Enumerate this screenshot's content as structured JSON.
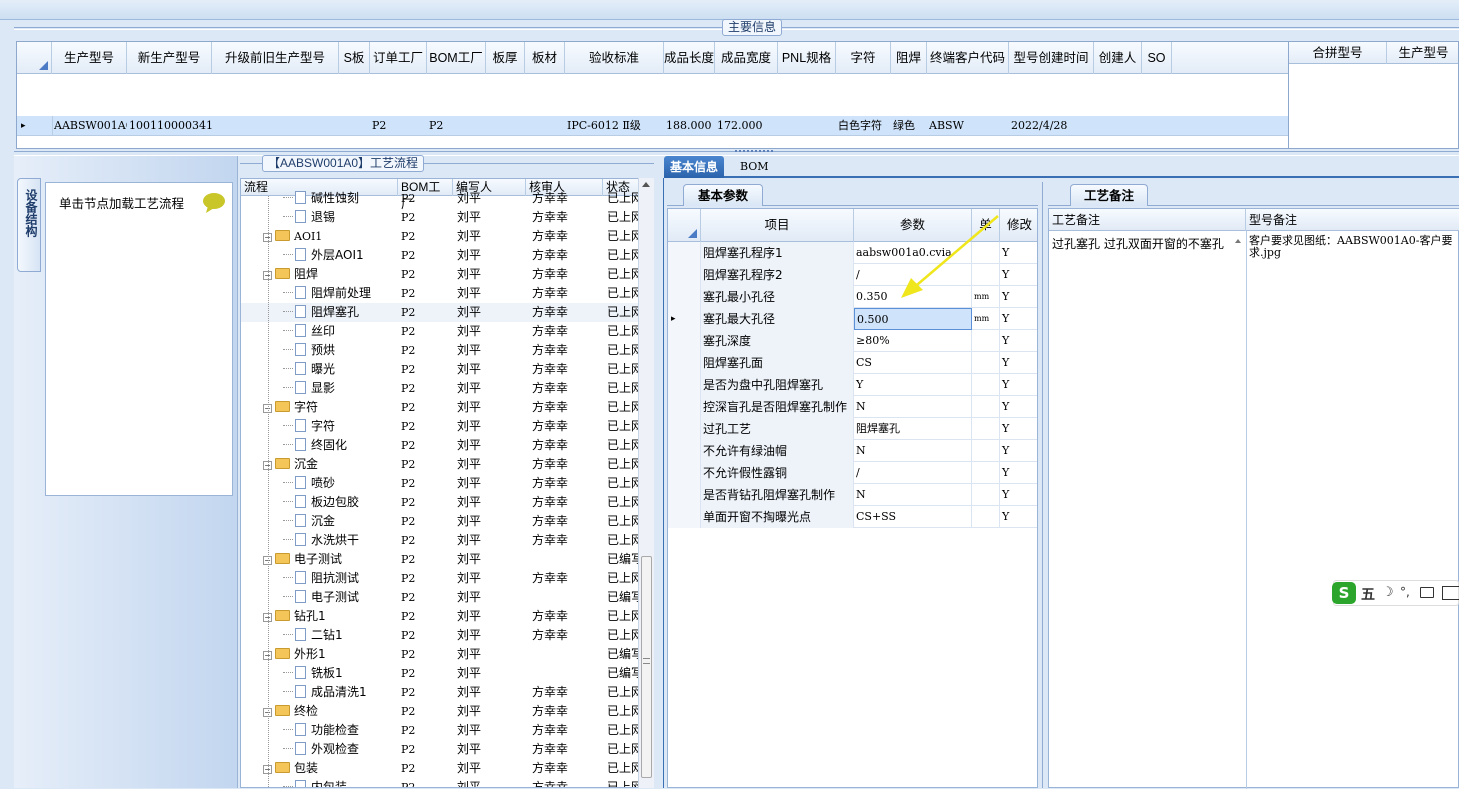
{
  "main_caption": "主要信息",
  "top_grid": {
    "headers": [
      "生产型号",
      "新生产型号",
      "升级前旧生产型号",
      "S板",
      "订单工厂",
      "BOM工厂",
      "板厚",
      "板材",
      "验收标准",
      "成品长度",
      "成品宽度",
      "PNL规格",
      "字符",
      "阻焊",
      "终端客户代码",
      "型号创建时间",
      "创建人",
      "SO"
    ],
    "row": [
      "AABSW001A0",
      "10011000034110",
      "",
      "",
      "P2",
      "P2",
      "",
      "",
      "IPC-6012 Ⅱ级",
      "188.000",
      "172.000",
      "",
      "白色字符",
      "绿色",
      "ABSW",
      "2022/4/28",
      "",
      ""
    ],
    "row_marker": "▸"
  },
  "side_grid": {
    "headers": [
      "合拼型号",
      "生产型号"
    ]
  },
  "left_panel": {
    "vertical_tab": "设备结构",
    "node_hint": "单击节点加载工艺流程"
  },
  "flow_caption": "【AABSW001A0】工艺流程",
  "tree": {
    "headers": [
      "流程",
      "BOM工厂",
      "编写人",
      "核审人",
      "状态"
    ],
    "rows": [
      {
        "lv": 2,
        "t": "page",
        "name": "碱性蚀刻",
        "bom": "P2",
        "w": "刘平",
        "r": "方幸幸",
        "s": "已上网"
      },
      {
        "lv": 2,
        "t": "page",
        "name": "退锡",
        "bom": "P2",
        "w": "刘平",
        "r": "方幸幸",
        "s": "已上网"
      },
      {
        "lv": 1,
        "t": "folder",
        "name": "AOI1",
        "bom": "P2",
        "w": "刘平",
        "r": "方幸幸",
        "s": "已上网",
        "mono": true
      },
      {
        "lv": 2,
        "t": "page",
        "name": "外层AOI1",
        "bom": "P2",
        "w": "刘平",
        "r": "方幸幸",
        "s": "已上网"
      },
      {
        "lv": 1,
        "t": "folder",
        "name": "阻焊",
        "bom": "P2",
        "w": "刘平",
        "r": "方幸幸",
        "s": "已上网"
      },
      {
        "lv": 2,
        "t": "page",
        "name": "阻焊前处理",
        "bom": "P2",
        "w": "刘平",
        "r": "方幸幸",
        "s": "已上网"
      },
      {
        "lv": 2,
        "t": "page",
        "name": "阻焊塞孔",
        "bom": "P2",
        "w": "刘平",
        "r": "方幸幸",
        "s": "已上网",
        "sel": true
      },
      {
        "lv": 2,
        "t": "page",
        "name": "丝印",
        "bom": "P2",
        "w": "刘平",
        "r": "方幸幸",
        "s": "已上网"
      },
      {
        "lv": 2,
        "t": "page",
        "name": "预烘",
        "bom": "P2",
        "w": "刘平",
        "r": "方幸幸",
        "s": "已上网"
      },
      {
        "lv": 2,
        "t": "page",
        "name": "曝光",
        "bom": "P2",
        "w": "刘平",
        "r": "方幸幸",
        "s": "已上网"
      },
      {
        "lv": 2,
        "t": "page",
        "name": "显影",
        "bom": "P2",
        "w": "刘平",
        "r": "方幸幸",
        "s": "已上网"
      },
      {
        "lv": 1,
        "t": "folder",
        "name": "字符",
        "bom": "P2",
        "w": "刘平",
        "r": "方幸幸",
        "s": "已上网"
      },
      {
        "lv": 2,
        "t": "page",
        "name": "字符",
        "bom": "P2",
        "w": "刘平",
        "r": "方幸幸",
        "s": "已上网"
      },
      {
        "lv": 2,
        "t": "page",
        "name": "终固化",
        "bom": "P2",
        "w": "刘平",
        "r": "方幸幸",
        "s": "已上网"
      },
      {
        "lv": 1,
        "t": "folder",
        "name": "沉金",
        "bom": "P2",
        "w": "刘平",
        "r": "方幸幸",
        "s": "已上网"
      },
      {
        "lv": 2,
        "t": "page",
        "name": "喷砂",
        "bom": "P2",
        "w": "刘平",
        "r": "方幸幸",
        "s": "已上网"
      },
      {
        "lv": 2,
        "t": "page",
        "name": "板边包胶",
        "bom": "P2",
        "w": "刘平",
        "r": "方幸幸",
        "s": "已上网"
      },
      {
        "lv": 2,
        "t": "page",
        "name": "沉金",
        "bom": "P2",
        "w": "刘平",
        "r": "方幸幸",
        "s": "已上网"
      },
      {
        "lv": 2,
        "t": "page",
        "name": "水洗烘干",
        "bom": "P2",
        "w": "刘平",
        "r": "方幸幸",
        "s": "已上网"
      },
      {
        "lv": 1,
        "t": "folder",
        "name": "电子测试",
        "bom": "P2",
        "w": "刘平",
        "r": "",
        "s": "已编写"
      },
      {
        "lv": 2,
        "t": "page",
        "name": "阻抗测试",
        "bom": "P2",
        "w": "刘平",
        "r": "方幸幸",
        "s": "已上网"
      },
      {
        "lv": 2,
        "t": "page",
        "name": "电子测试",
        "bom": "P2",
        "w": "刘平",
        "r": "",
        "s": "已编写"
      },
      {
        "lv": 1,
        "t": "folder",
        "name": "钻孔1",
        "bom": "P2",
        "w": "刘平",
        "r": "方幸幸",
        "s": "已上网"
      },
      {
        "lv": 2,
        "t": "page",
        "name": "二钻1",
        "bom": "P2",
        "w": "刘平",
        "r": "方幸幸",
        "s": "已上网"
      },
      {
        "lv": 1,
        "t": "folder",
        "name": "外形1",
        "bom": "P2",
        "w": "刘平",
        "r": "",
        "s": "已编写"
      },
      {
        "lv": 2,
        "t": "page",
        "name": "铣板1",
        "bom": "P2",
        "w": "刘平",
        "r": "",
        "s": "已编写"
      },
      {
        "lv": 2,
        "t": "page",
        "name": "成品清洗1",
        "bom": "P2",
        "w": "刘平",
        "r": "方幸幸",
        "s": "已上网"
      },
      {
        "lv": 1,
        "t": "folder",
        "name": "终检",
        "bom": "P2",
        "w": "刘平",
        "r": "方幸幸",
        "s": "已上网"
      },
      {
        "lv": 2,
        "t": "page",
        "name": "功能检查",
        "bom": "P2",
        "w": "刘平",
        "r": "方幸幸",
        "s": "已上网"
      },
      {
        "lv": 2,
        "t": "page",
        "name": "外观检查",
        "bom": "P2",
        "w": "刘平",
        "r": "方幸幸",
        "s": "已上网"
      },
      {
        "lv": 1,
        "t": "folder",
        "name": "包装",
        "bom": "P2",
        "w": "刘平",
        "r": "方幸幸",
        "s": "已上网"
      },
      {
        "lv": 2,
        "t": "page",
        "name": "内包装",
        "bom": "P2",
        "w": "刘平",
        "r": "方幸幸",
        "s": "已上网"
      }
    ]
  },
  "tabs": [
    "基本信息",
    "BOM"
  ],
  "basic_params_tab": "基本参数",
  "params": {
    "headers": [
      "项目",
      "参数",
      "单",
      "修改"
    ],
    "rows": [
      {
        "item": "阻焊塞孔程序1",
        "val": "aabsw001a0.cvia",
        "unit": "",
        "mod": "Y"
      },
      {
        "item": "阻焊塞孔程序2",
        "val": "/",
        "unit": "",
        "mod": "Y"
      },
      {
        "item": "塞孔最小孔径",
        "val": "0.350",
        "unit": "mm",
        "mod": "Y"
      },
      {
        "item": "塞孔最大孔径",
        "val": "0.500",
        "unit": "mm",
        "mod": "Y",
        "sel": true
      },
      {
        "item": "塞孔深度",
        "val": "≥80%",
        "unit": "",
        "mod": "Y"
      },
      {
        "item": "阻焊塞孔面",
        "val": "CS",
        "unit": "",
        "mod": "Y"
      },
      {
        "item": "是否为盘中孔阻焊塞孔",
        "val": "Y",
        "unit": "",
        "mod": "Y"
      },
      {
        "item": "控深盲孔是否阻焊塞孔制作",
        "val": "N",
        "unit": "",
        "mod": "Y"
      },
      {
        "item": "过孔工艺",
        "val": "阻焊塞孔",
        "unit": "",
        "mod": "Y"
      },
      {
        "item": "不允许有绿油帽",
        "val": "N",
        "unit": "",
        "mod": "Y"
      },
      {
        "item": "不允许假性露铜",
        "val": "/",
        "unit": "",
        "mod": "Y"
      },
      {
        "item": "是否背钻孔阻焊塞孔制作",
        "val": "N",
        "unit": "",
        "mod": "Y"
      },
      {
        "item": "单面开窗不掏曝光点",
        "val": "CS+SS",
        "unit": "",
        "mod": "Y"
      }
    ]
  },
  "notes_tab": "工艺备注",
  "notes": {
    "headers": [
      "工艺备注",
      "型号备注"
    ],
    "process_note": "过孔塞孔 过孔双面开窗的不塞孔",
    "model_note": "客户要求见图纸：AABSW001A0-客户要求.jpg"
  },
  "ime": {
    "logo": "S",
    "mode": "五"
  }
}
